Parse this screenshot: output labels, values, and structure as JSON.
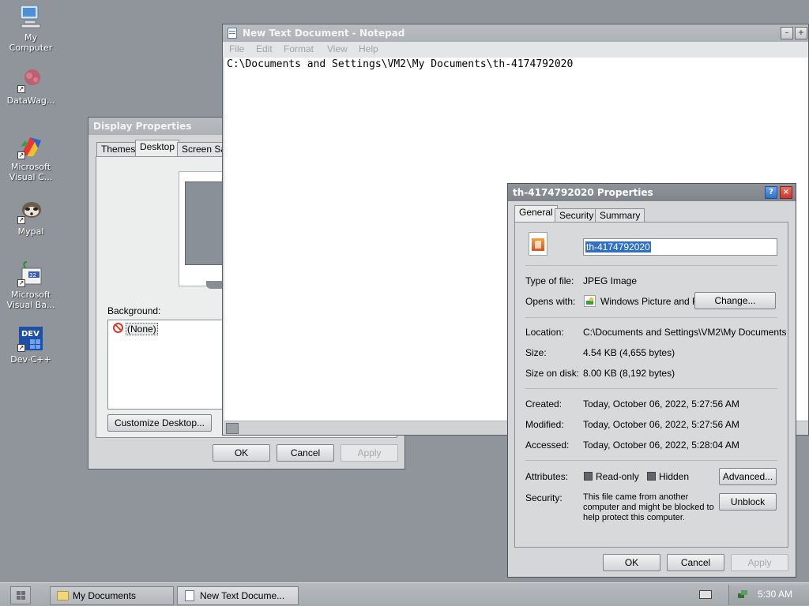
{
  "desktop": {
    "icons": [
      {
        "label": "My\nComputer",
        "icon": "computer-icon"
      },
      {
        "label": "DataWag...",
        "icon": "datawagon-icon"
      },
      {
        "label": "Microsoft\nVisual C...",
        "icon": "visual-c-icon"
      },
      {
        "label": "Mypal",
        "icon": "mypal-icon"
      },
      {
        "label": "Microsoft\nVisual Ba...",
        "icon": "visual-basic-icon"
      },
      {
        "label": "Dev-C++",
        "icon": "devcpp-icon"
      }
    ]
  },
  "notepad": {
    "title": "New Text Document - Notepad",
    "menu": [
      "File",
      "Edit",
      "Format",
      "View",
      "Help"
    ],
    "content": "C:\\Documents and Settings\\VM2\\My Documents\\th-4174792020"
  },
  "display_properties": {
    "title": "Display Properties",
    "tabs": [
      "Themes",
      "Desktop",
      "Screen Sa"
    ],
    "background_label": "Background:",
    "background_items": [
      "(None)"
    ],
    "customize_button": "Customize Desktop...",
    "ok": "OK",
    "cancel": "Cancel",
    "apply": "Apply"
  },
  "file_properties": {
    "title": "th-4174792020 Properties",
    "tabs": [
      "General",
      "Security",
      "Summary"
    ],
    "filename": "th-4174792020",
    "type_label": "Type of file:",
    "type_value": "JPEG Image",
    "opens_label": "Opens with:",
    "opens_value": "Windows Picture and F",
    "change_button": "Change...",
    "location_label": "Location:",
    "location_value": "C:\\Documents and Settings\\VM2\\My Documents",
    "size_label": "Size:",
    "size_value": "4.54 KB (4,655 bytes)",
    "size_disk_label": "Size on disk:",
    "size_disk_value": "8.00 KB (8,192 bytes)",
    "created_label": "Created:",
    "created_value": "Today, October 06, 2022, 5:27:56 AM",
    "modified_label": "Modified:",
    "modified_value": "Today, October 06, 2022, 5:27:56 AM",
    "accessed_label": "Accessed:",
    "accessed_value": "Today, October 06, 2022, 5:28:04 AM",
    "attributes_label": "Attributes:",
    "readonly_label": "Read-only",
    "hidden_label": "Hidden",
    "advanced_button": "Advanced...",
    "security_label": "Security:",
    "security_text": "This file came from another\ncomputer and might be blocked to\nhelp protect this computer.",
    "unblock_button": "Unblock",
    "ok": "OK",
    "cancel": "Cancel",
    "apply": "Apply"
  },
  "taskbar": {
    "buttons": [
      "My Documents",
      "New Text Docume..."
    ],
    "clock": "5:30 AM"
  },
  "colors": {
    "desktop": "#8f959b",
    "accent_blue": "#2f6fc4"
  }
}
